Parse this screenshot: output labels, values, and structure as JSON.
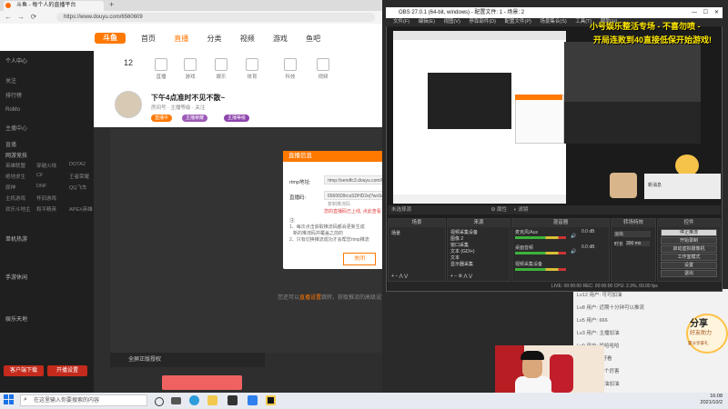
{
  "browser": {
    "tab_title": "斗鱼 - 每个人的直播平台",
    "url": "https://www.douyu.com/6560609",
    "back": "←",
    "forward": "→",
    "refresh": "⟳"
  },
  "site": {
    "logo": "斗鱼",
    "nav": [
      "首页",
      "直播",
      "分类",
      "视频",
      "游戏",
      "鱼吧"
    ],
    "sidebar_head": "个人中心",
    "sidebar_items": [
      "关注",
      "排行榜",
      "RoMo",
      "主播中心",
      "直播"
    ],
    "sidebar_sections": [
      "网游竞技",
      "单机热游",
      "手游休闲",
      "娱乐天地"
    ],
    "sidebar_grid": [
      "英雄联盟",
      "穿越火线",
      "DOTA2",
      "绝地求生",
      "CF",
      "王者荣耀",
      "原神",
      "DNF",
      "QQ飞车",
      "主机游戏",
      "怀旧游戏",
      "欢乐斗地主",
      "和平精英",
      "APEX英雄"
    ],
    "sidebar_btn1": "客户端下载",
    "sidebar_btn2": "开播设置",
    "categories": [
      "12",
      "直播",
      "游戏",
      "娱乐",
      "体育",
      "科技",
      "视频"
    ],
    "room_title": "下午4点准时不见不散~",
    "room_sub": "房间号 · 主播等级 · 关注",
    "badges": [
      "直播中",
      "主播荣耀",
      "主播等级"
    ],
    "player_tip_pre": "您还可以",
    "player_tip_link": "直播设置",
    "player_tip_post": "跳转，获取推流的高级设置",
    "gift_panel": "全屏正版授权",
    "dialog": {
      "title": "直播信息",
      "rtmp_label": "rtmp地址:",
      "rtmp_value": "rtmp://sendfc3.douyu.com/live",
      "code_label": "直播码:",
      "code_value": "6560609rcsSDHD2ej?wsSecret=...",
      "copy_hint": "复制推流码",
      "warn": "您的直播码已上线, 点此查看",
      "notes": [
        "注:",
        "1、每次点击获取推流码都会更新生成",
        "新的推流码并覆盖之前的",
        "2、只有切换推流成功才会帮您rtmp推流"
      ],
      "close": "关闭"
    },
    "chat_lines": [
      "Lv12 用户: 可可加油",
      "Lv8 用户: 近期十分钟可以推流",
      "Lv5 用户: 666",
      "Lv3 用户: 主播加油",
      "Lv9 用户: 哈哈哈哈",
      "Lv15 用户: 好看",
      "Lv6 用户: 这个厉害",
      "Lv2 用户: 加油加油"
    ],
    "share_t1": "分享",
    "share_t2": "好友助力",
    "share_t3": "赢分享豪礼"
  },
  "banner": {
    "line1": "小号娱乐整活专场 - 不喜勿喷 -",
    "line2": "开局连败到40直接低保开始游戏!"
  },
  "obs": {
    "title": "OBS 27.0.1 (64-bit, windows) - 配置文件: 1 - 场景: 2",
    "menu": [
      "文件(F)",
      "编辑(E)",
      "视图(V)",
      "停靠部件(D)",
      "配置文件(P)",
      "场景集合(S)",
      "工具(T)",
      "帮助(H)"
    ],
    "preview_label": "未选择源",
    "preview_props": "属性",
    "preview_filters": "滤镜",
    "panels": {
      "scenes": "场景",
      "sources": "来源",
      "mixer": "混音器",
      "transitions": "转场特效",
      "controls": "控件"
    },
    "scene_item": "场景",
    "source_items": [
      "视频采集设备",
      "图像 2",
      "窗口采集",
      "文本 (GDI+)",
      "文本",
      "显示器采集"
    ],
    "mixer_items": [
      "麦克风/Aux",
      "桌面音频",
      "视频采集设备"
    ],
    "mixer_db": "0.0 dB",
    "transition_name": "淡出",
    "transition_dur_label": "时长",
    "transition_dur": "300 ms",
    "control_buttons": [
      "停止推流",
      "开始录制",
      "启动虚拟摄像机",
      "工作室模式",
      "设置",
      "退出"
    ],
    "status": "LIVE: 00:00:00   REC: 00:00:00   CPU: 2.3%, 60.00 fps",
    "popup": "新消息"
  },
  "taskbar": {
    "search_placeholder": "在这里输入你要搜索的内容",
    "time": "16:08",
    "date": "2021/10/2"
  }
}
